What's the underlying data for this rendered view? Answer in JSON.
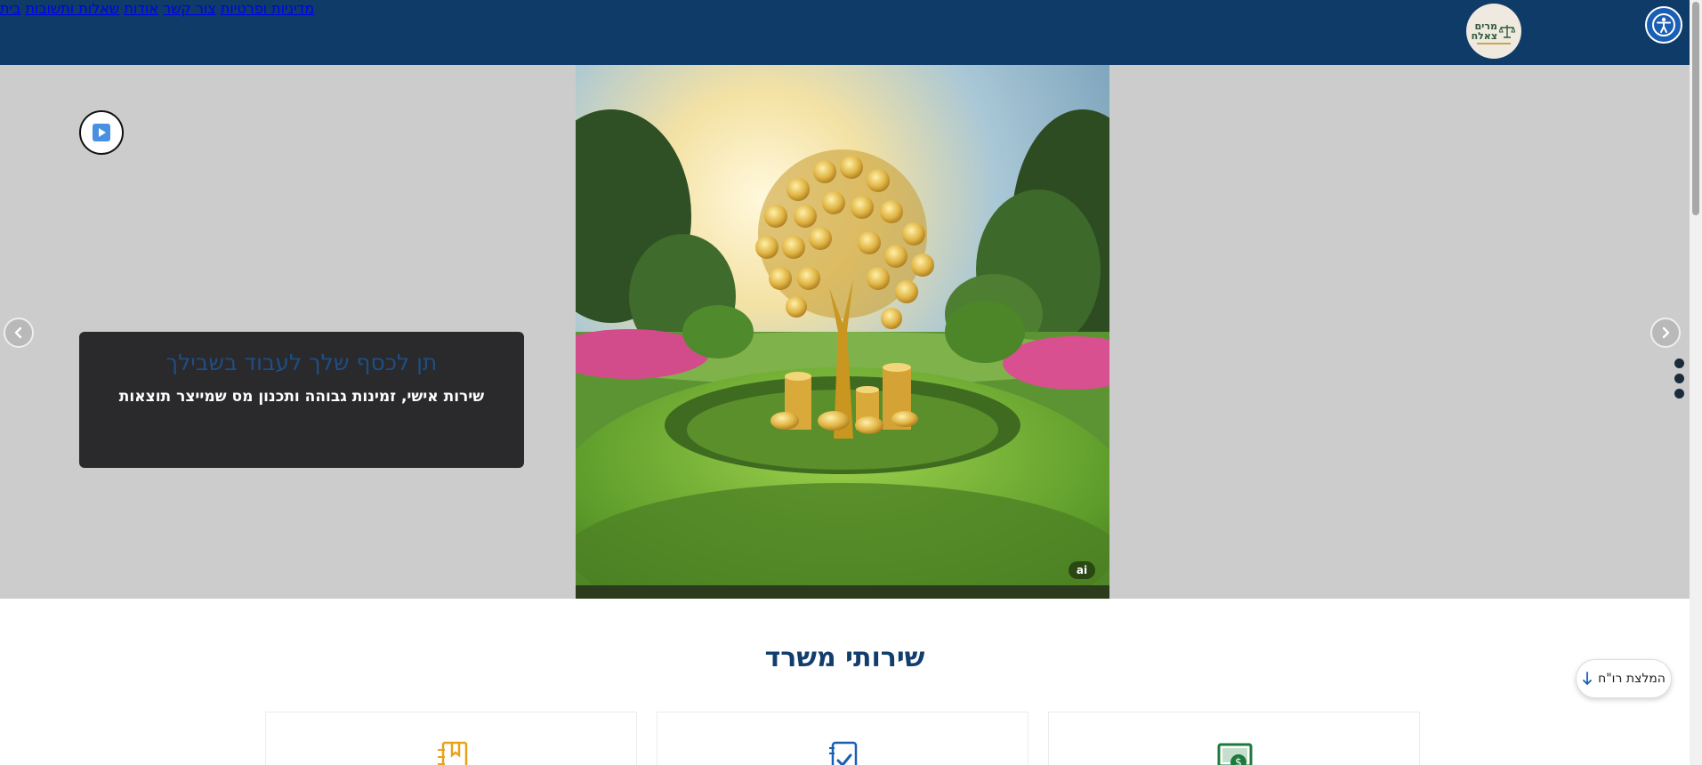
{
  "header": {
    "logo_text": "מרים צאלח",
    "nav": [
      {
        "label": "בית"
      },
      {
        "label": "שאלות ותשובות"
      },
      {
        "label": "אודות"
      },
      {
        "label": "צור קשר"
      },
      {
        "label": "מדיניות ופרטיות"
      }
    ]
  },
  "hero": {
    "title": "תן לכסף שלך לעבוד בשבילך",
    "subtitle": "שירות אישי, זמינות גבוהה ותכנון מס שמייצר תוצאות",
    "ai_badge": "ai",
    "slide_count": 3
  },
  "services": {
    "title": "שירותי משרד",
    "cards": [
      {
        "icon": "cash-icon",
        "color": "#1e7a3c"
      },
      {
        "icon": "checklist-icon",
        "color": "#1a5fb4"
      },
      {
        "icon": "bookmark-book-icon",
        "color": "#e8a317"
      }
    ]
  },
  "recommend_button": {
    "label": "המלצת רו\"ח"
  },
  "colors": {
    "header_bg": "#0f3b68",
    "hero_bg": "#cccccc",
    "caption_bg": "#2a292b",
    "accent": "#1a5fb4"
  }
}
